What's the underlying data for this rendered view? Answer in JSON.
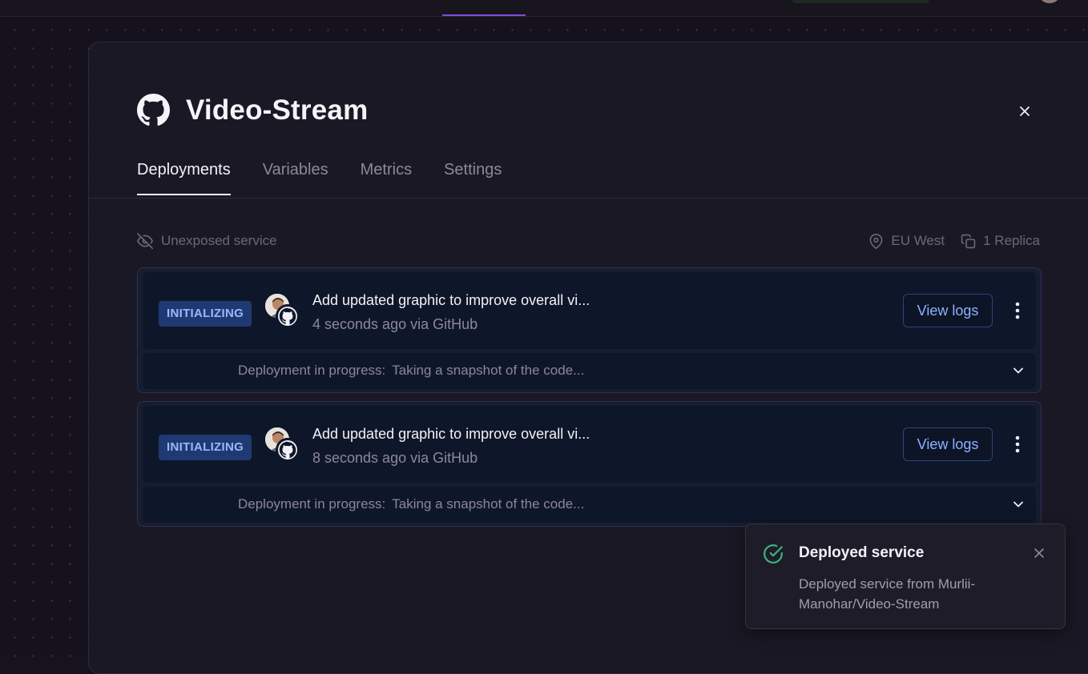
{
  "service": {
    "name": "Video-Stream",
    "source_icon": "github-icon"
  },
  "tabs": [
    {
      "label": "Deployments",
      "active": true
    },
    {
      "label": "Variables",
      "active": false
    },
    {
      "label": "Metrics",
      "active": false
    },
    {
      "label": "Settings",
      "active": false
    }
  ],
  "meta": {
    "exposure": "Unexposed service",
    "region": "EU West",
    "replicas": "1 Replica"
  },
  "deployments": [
    {
      "status": "INITIALIZING",
      "commit_message": "Add updated graphic to improve overall vi...",
      "subtitle": "4 seconds ago via GitHub",
      "view_logs_label": "View logs",
      "progress_label": "Deployment in progress:",
      "progress_detail": "Taking a snapshot of the code..."
    },
    {
      "status": "INITIALIZING",
      "commit_message": "Add updated graphic to improve overall vi...",
      "subtitle": "8 seconds ago via GitHub",
      "view_logs_label": "View logs",
      "progress_label": "Deployment in progress:",
      "progress_detail": "Taking a snapshot of the code..."
    }
  ],
  "toast": {
    "title": "Deployed service",
    "message": "Deployed service from Murlii-Manohar/Video-Stream"
  },
  "colors": {
    "background": "#15121d",
    "panel": "#1b1825",
    "accent": "#7b4fd8",
    "status_badge": "#1f3a72",
    "status_badge_text": "#9cb6ff",
    "link_blue": "#8db1ff",
    "success_green": "#3fb27f"
  }
}
